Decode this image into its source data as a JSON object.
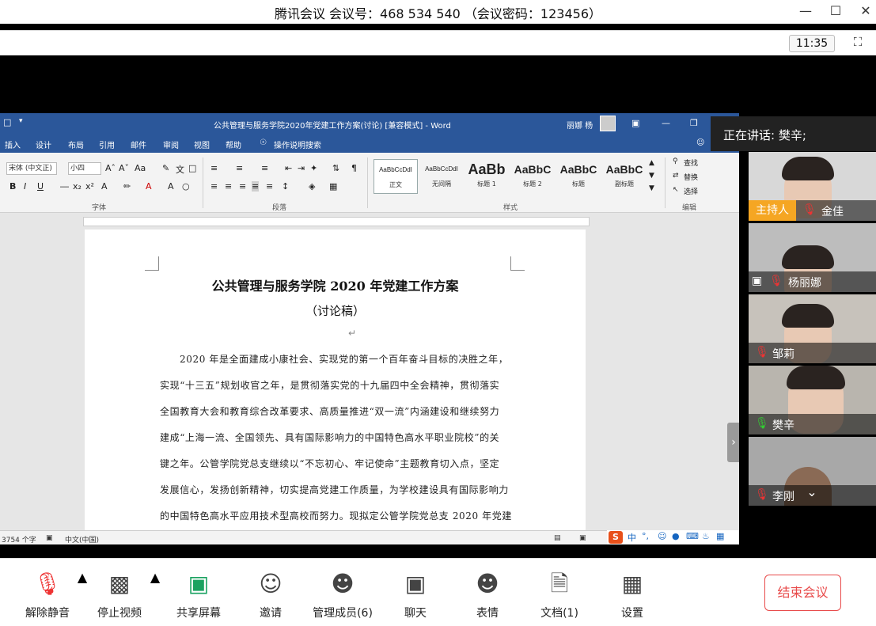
{
  "window": {
    "title": "腾讯会议 会议号：468 534 540 （会议密码：123456）",
    "clock": "11:35"
  },
  "word": {
    "doc_title": "公共管理与服务学院2020年党建工作方案(讨论) [兼容模式] - Word",
    "user": "丽娜 杨",
    "tabs": [
      "插入",
      "设计",
      "布局",
      "引用",
      "邮件",
      "审阅",
      "视图",
      "帮助",
      "操作说明搜索"
    ],
    "font_name": "宋体 (中文正)",
    "font_size": "小四",
    "styles": [
      {
        "sample": "AaBbCcDdI",
        "label": "正文"
      },
      {
        "sample": "AaBbCcDdI",
        "label": "无间隔"
      },
      {
        "sample": "AaBb",
        "label": "标题 1"
      },
      {
        "sample": "AaBbC",
        "label": "标题 2"
      },
      {
        "sample": "AaBbC",
        "label": "标题"
      },
      {
        "sample": "AaBbC",
        "label": "副标题"
      }
    ],
    "groups": {
      "font": "字体",
      "paragraph": "段落",
      "styles": "样式",
      "editing": "编辑"
    },
    "editing": [
      "查找",
      "替换",
      "选择"
    ],
    "heading1": "公共管理与服务学院 2020 年党建工作方案",
    "heading2": "（讨论稿）",
    "lines": [
      "2020 年是全面建成小康社会、实现党的第一个百年奋斗目标的决胜之年，",
      "实现“十三五”规划收官之年，是贯彻落实党的十九届四中全会精神，贯彻落实",
      "全国教育大会和教育综合改革要求、高质量推进“双一流”内涵建设和继续努力",
      "建成“上海一流、全国领先、具有国际影响力的中国特色高水平职业院校”的关",
      "键之年。公管学院党总支继续以“不忘初心、牢记使命”主题教育切入点，坚定",
      "发展信心，发扬创新精神，切实提高党建工作质量，为学校建设具有国际影响力",
      "的中国特色高水平应用技术型高校而努力。现拟定公管学院党总支 2020 年党建"
    ],
    "status": {
      "words": "3754 个字",
      "lang": "中文(中国)"
    }
  },
  "panel": {
    "speaking": "正在讲话: 樊辛;",
    "participants": [
      {
        "name": "金佳",
        "host_badge": "主持人"
      },
      {
        "name": "杨丽娜"
      },
      {
        "name": "邹莉"
      },
      {
        "name": "樊辛"
      },
      {
        "name": "李刚"
      }
    ]
  },
  "toolbar": {
    "unmute": "解除静音",
    "stop_video": "停止视频",
    "share": "共享屏幕",
    "invite": "邀请",
    "manage": "管理成员(6)",
    "chat": "聊天",
    "emoji": "表情",
    "docs": "文档(1)",
    "settings": "设置",
    "end": "结束会议"
  }
}
